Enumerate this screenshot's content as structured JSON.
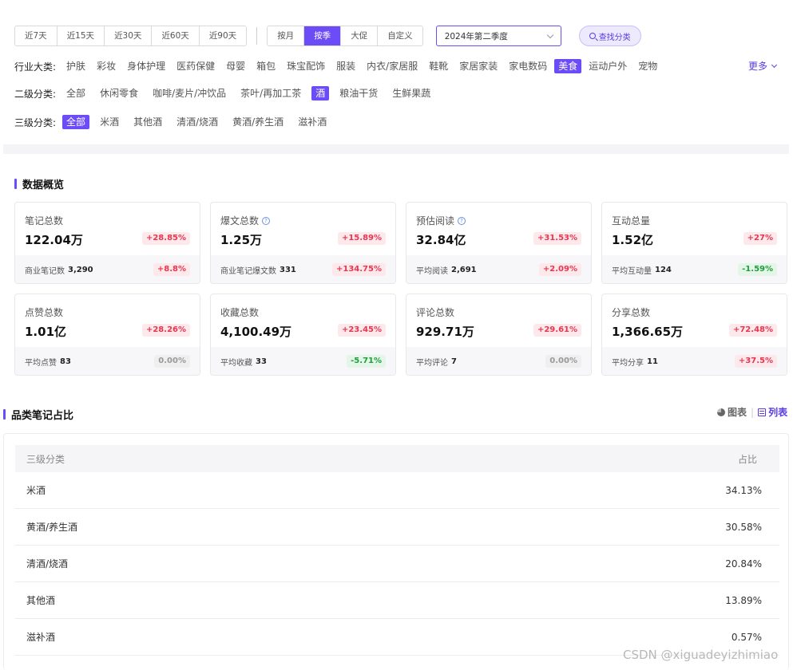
{
  "filters": {
    "range_tabs": [
      "近7天",
      "近15天",
      "近30天",
      "近60天",
      "近90天"
    ],
    "period_tabs": [
      "按月",
      "按季",
      "大促",
      "自定义"
    ],
    "period_active": "按季",
    "quarter_select": "2024年第二季度",
    "find_category_label": "查找分类"
  },
  "industry": {
    "label": "行业大类:",
    "items": [
      "护肤",
      "彩妆",
      "身体护理",
      "医药保健",
      "母婴",
      "箱包",
      "珠宝配饰",
      "服装",
      "内衣/家居服",
      "鞋靴",
      "家居家装",
      "家电数码",
      "美食",
      "运动户外",
      "宠物"
    ],
    "active": "美食",
    "more_label": "更多"
  },
  "level2": {
    "label": "二级分类:",
    "items": [
      "全部",
      "休闲零食",
      "咖啡/麦片/冲饮品",
      "茶叶/再加工茶",
      "酒",
      "粮油干货",
      "生鲜果蔬"
    ],
    "active": "酒"
  },
  "level3": {
    "label": "三级分类:",
    "items": [
      "全部",
      "米酒",
      "其他酒",
      "清酒/烧酒",
      "黄酒/养生酒",
      "滋补酒"
    ],
    "active": "全部"
  },
  "overview": {
    "title": "数据概览",
    "cards": [
      {
        "name": "笔记总数",
        "value": "122.04万",
        "change": "+28.85%",
        "tone": "red",
        "help": false,
        "sub_label": "商业笔记数",
        "sub_value": "3,290",
        "sub_change": "+8.8%",
        "sub_tone": "red"
      },
      {
        "name": "爆文总数",
        "value": "1.25万",
        "change": "+15.89%",
        "tone": "red",
        "help": true,
        "sub_label": "商业笔记爆文数",
        "sub_value": "331",
        "sub_change": "+134.75%",
        "sub_tone": "red"
      },
      {
        "name": "预估阅读",
        "value": "32.84亿",
        "change": "+31.53%",
        "tone": "red",
        "help": true,
        "sub_label": "平均阅读",
        "sub_value": "2,691",
        "sub_change": "+2.09%",
        "sub_tone": "red"
      },
      {
        "name": "互动总量",
        "value": "1.52亿",
        "change": "+27%",
        "tone": "red",
        "help": false,
        "sub_label": "平均互动量",
        "sub_value": "124",
        "sub_change": "-1.59%",
        "sub_tone": "green"
      },
      {
        "name": "点赞总数",
        "value": "1.01亿",
        "change": "+28.26%",
        "tone": "red",
        "help": false,
        "sub_label": "平均点赞",
        "sub_value": "83",
        "sub_change": "0.00%",
        "sub_tone": "gray"
      },
      {
        "name": "收藏总数",
        "value": "4,100.49万",
        "change": "+23.45%",
        "tone": "red",
        "help": false,
        "sub_label": "平均收藏",
        "sub_value": "33",
        "sub_change": "-5.71%",
        "sub_tone": "green"
      },
      {
        "name": "评论总数",
        "value": "929.71万",
        "change": "+29.61%",
        "tone": "red",
        "help": false,
        "sub_label": "平均评论",
        "sub_value": "7",
        "sub_change": "0.00%",
        "sub_tone": "gray"
      },
      {
        "name": "分享总数",
        "value": "1,366.65万",
        "change": "+72.48%",
        "tone": "red",
        "help": false,
        "sub_label": "平均分享",
        "sub_value": "11",
        "sub_change": "+37.5%",
        "sub_tone": "red"
      }
    ]
  },
  "share": {
    "title": "品类笔记占比",
    "view_chart": "图表",
    "view_list": "列表",
    "columns": [
      "三级分类",
      "占比"
    ],
    "rows": [
      [
        "米酒",
        "34.13%"
      ],
      [
        "黄酒/养生酒",
        "30.58%"
      ],
      [
        "清酒/烧酒",
        "20.84%"
      ],
      [
        "其他酒",
        "13.89%"
      ],
      [
        "滋补酒",
        "0.57%"
      ]
    ]
  },
  "watermark": "CSDN @xiguadeyizhimiao",
  "colors": {
    "accent": "#6c4cf6",
    "up": "#e8364e",
    "down": "#1f9d3b"
  }
}
